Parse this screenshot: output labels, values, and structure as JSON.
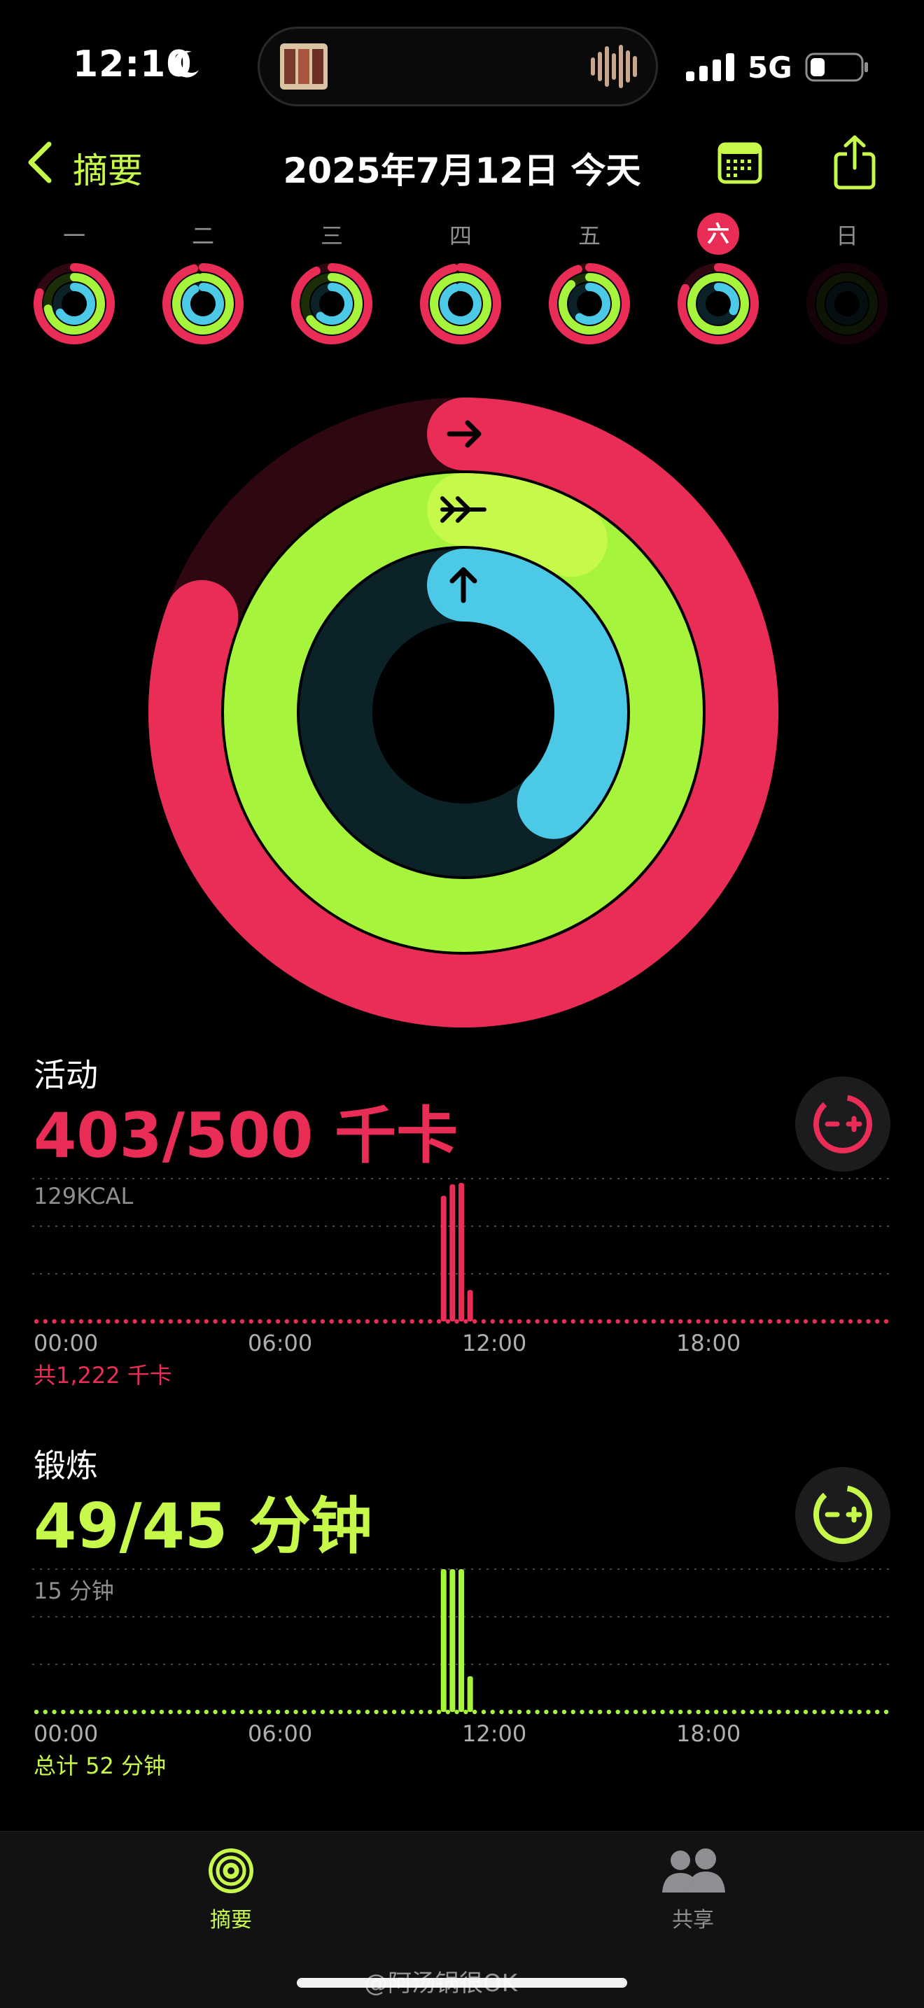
{
  "status": {
    "time": "12:10",
    "network": "5G"
  },
  "header": {
    "back_label": "摘要",
    "title": "2025年7月12日 今天"
  },
  "week": {
    "days": [
      "一",
      "二",
      "三",
      "四",
      "五",
      "六",
      "日"
    ],
    "today_index": 5,
    "rings": [
      {
        "move": 0.8,
        "exercise": 0.72,
        "stand": 0.66
      },
      {
        "move": 0.96,
        "exercise": 0.97,
        "stand": 0.92
      },
      {
        "move": 0.93,
        "exercise": 0.65,
        "stand": 0.62
      },
      {
        "move": 0.97,
        "exercise": 0.98,
        "stand": 0.95
      },
      {
        "move": 0.95,
        "exercise": 0.88,
        "stand": 0.6
      },
      {
        "move": 0.82,
        "exercise": 1.0,
        "stand": 0.32
      },
      {
        "move": 0,
        "exercise": 0,
        "stand": 0
      }
    ]
  },
  "rings": {
    "move": 0.806,
    "exercise": 1.089,
    "stand": 0.375,
    "colors": {
      "move": "#ea2d57",
      "exercise": "#a6f43c",
      "stand": "#4cc9e6"
    }
  },
  "activity": {
    "label": "活动",
    "value": "403/500 千卡",
    "axis_max": "129KCAL",
    "total": "共1,222 千卡",
    "ticks": [
      "00:00",
      "06:00",
      "12:00",
      "18:00"
    ],
    "bars": [
      {
        "hour": 11.5,
        "value": 0.88
      },
      {
        "hour": 11.75,
        "value": 0.96
      },
      {
        "hour": 12.0,
        "value": 0.97
      },
      {
        "hour": 12.25,
        "value": 0.22
      }
    ]
  },
  "exercise": {
    "label": "锻炼",
    "value": "49/45 分钟",
    "axis_max": "15 分钟",
    "total": "总计 52 分钟",
    "ticks": [
      "00:00",
      "06:00",
      "12:00",
      "18:00"
    ],
    "bars": [
      {
        "hour": 11.5,
        "value": 1.0
      },
      {
        "hour": 11.75,
        "value": 1.0
      },
      {
        "hour": 12.0,
        "value": 1.0
      },
      {
        "hour": 12.25,
        "value": 0.25
      }
    ]
  },
  "tabs": [
    {
      "label": "摘要",
      "active": true
    },
    {
      "label": "共享",
      "active": false
    }
  ],
  "watermark": "@阿汤锅很OK"
}
